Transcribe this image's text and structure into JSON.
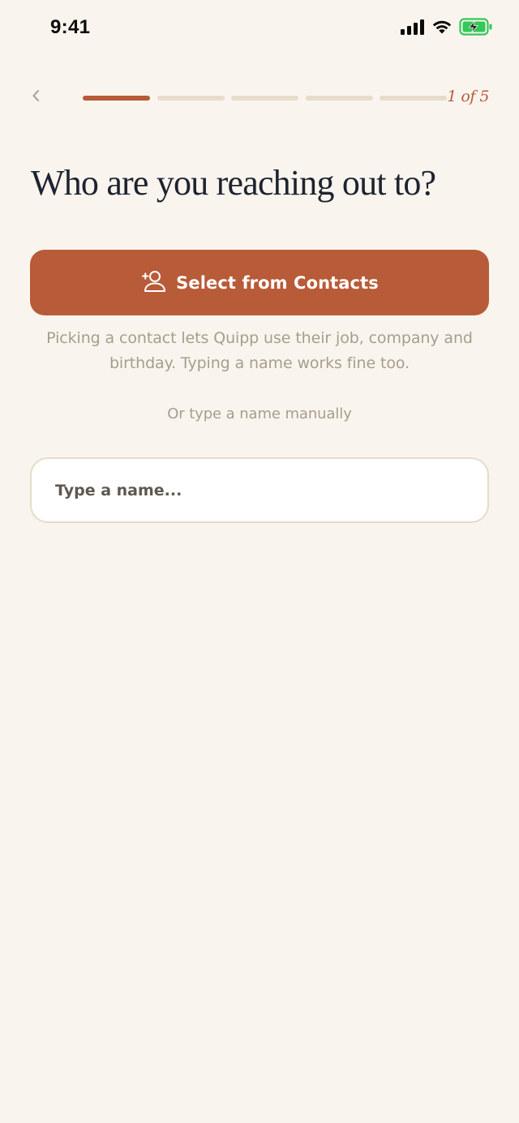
{
  "status_bar": {
    "time": "9:41"
  },
  "nav": {
    "back_icon": "chevron-left-icon",
    "step_counter": "1 of 5",
    "steps_total": 5,
    "steps_completed": 1
  },
  "title": "Who are you reaching out to?",
  "contacts_button": {
    "label": "Select from Contacts",
    "icon": "add-person-icon"
  },
  "helper_text": "Picking a contact lets Quipp use their job, company and birthday. Typing a name works fine too.",
  "or_label": "Or type a name manually",
  "name_input": {
    "placeholder": "Type a name...",
    "value": ""
  },
  "colors": {
    "background": "#F9F5EE",
    "accent": "#B85B38",
    "progress_inactive": "#E7DCCB",
    "muted_text": "#A89D8B",
    "title_text": "#1E2330",
    "input_border": "#E6DCC9",
    "battery_green": "#34C759"
  }
}
